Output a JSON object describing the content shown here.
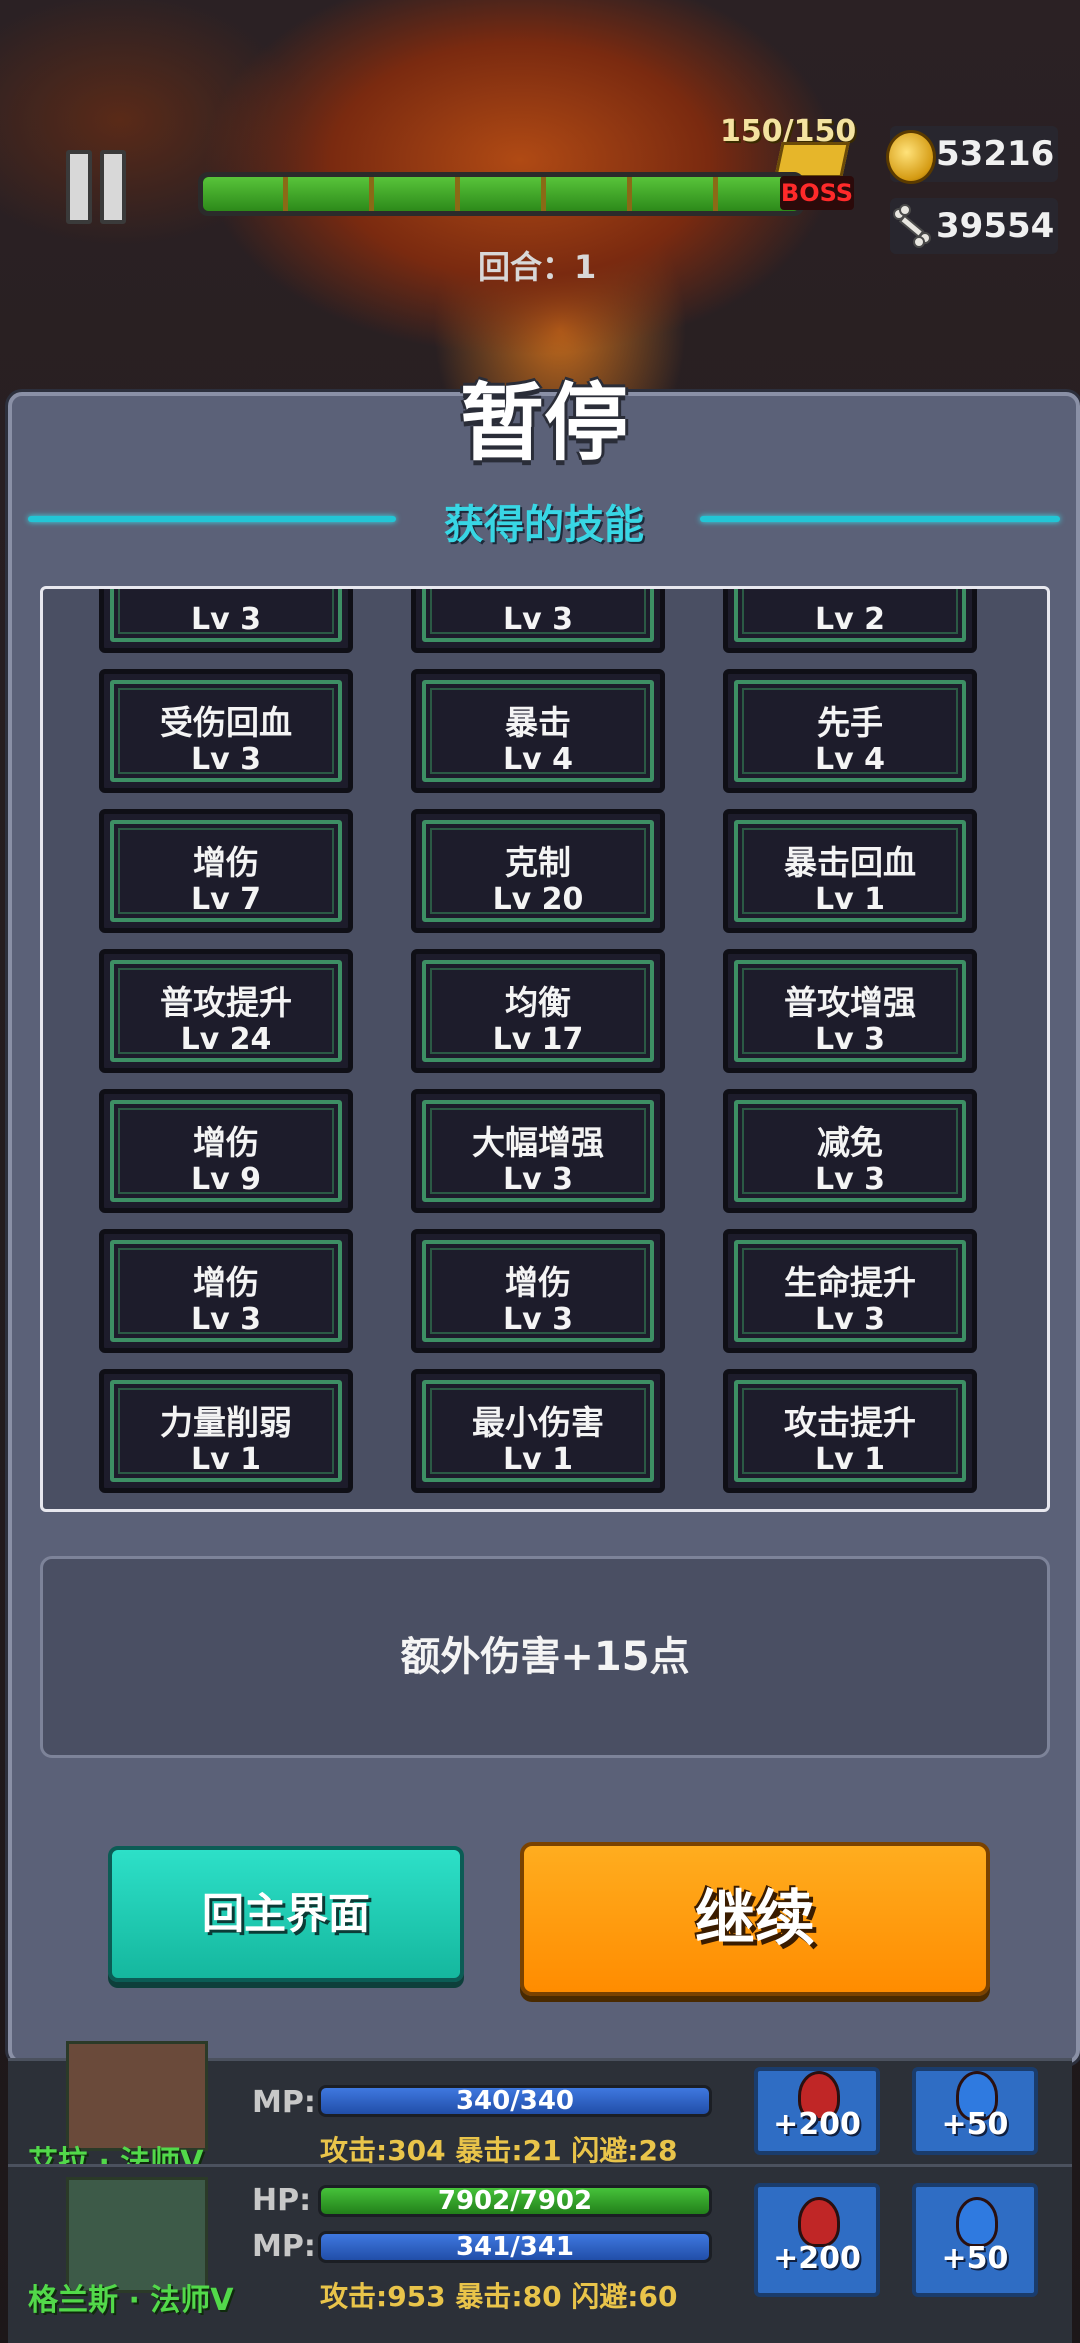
{
  "hud": {
    "boss_hp": "150/150",
    "boss_label": "BOSS",
    "gold": "53216",
    "bones": "39554",
    "round": "回合：1"
  },
  "pause": {
    "title": "暂停",
    "section_title": "获得的技能",
    "skills": [
      {
        "name": "",
        "level": "Lv 3"
      },
      {
        "name": "",
        "level": "Lv 3"
      },
      {
        "name": "",
        "level": "Lv 2"
      },
      {
        "name": "受伤回血",
        "level": "Lv 3"
      },
      {
        "name": "暴击",
        "level": "Lv 4"
      },
      {
        "name": "先手",
        "level": "Lv 4"
      },
      {
        "name": "增伤",
        "level": "Lv 7"
      },
      {
        "name": "克制",
        "level": "Lv 20"
      },
      {
        "name": "暴击回血",
        "level": "Lv 1"
      },
      {
        "name": "普攻提升",
        "level": "Lv 24"
      },
      {
        "name": "均衡",
        "level": "Lv 17"
      },
      {
        "name": "普攻增强",
        "level": "Lv 3"
      },
      {
        "name": "增伤",
        "level": "Lv 9"
      },
      {
        "name": "大幅增强",
        "level": "Lv 3"
      },
      {
        "name": "减免",
        "level": "Lv 3"
      },
      {
        "name": "增伤",
        "level": "Lv 3"
      },
      {
        "name": "增伤",
        "level": "Lv 3"
      },
      {
        "name": "生命提升",
        "level": "Lv 3"
      },
      {
        "name": "力量削弱",
        "level": "Lv 1"
      },
      {
        "name": "最小伤害",
        "level": "Lv 1"
      },
      {
        "name": "攻击提升",
        "level": "Lv 1"
      }
    ],
    "description": "额外伤害+15点",
    "home_button": "回主界面",
    "continue_button": "继续"
  },
  "heroes": [
    {
      "name": "艾拉 · 法师Ⅴ",
      "mp_label": "MP:",
      "mp": "340/340",
      "stats": "攻击:304 暴击:21 闪避:28",
      "hp_potion": "+200",
      "mp_potion": "+50"
    },
    {
      "name": "格兰斯 · 法师Ⅴ",
      "hp_label": "HP:",
      "hp": "7902/7902",
      "mp_label": "MP:",
      "mp": "341/341",
      "stats": "攻击:953 暴击:80 闪避:60",
      "hp_potion": "+200",
      "mp_potion": "+50"
    }
  ]
}
